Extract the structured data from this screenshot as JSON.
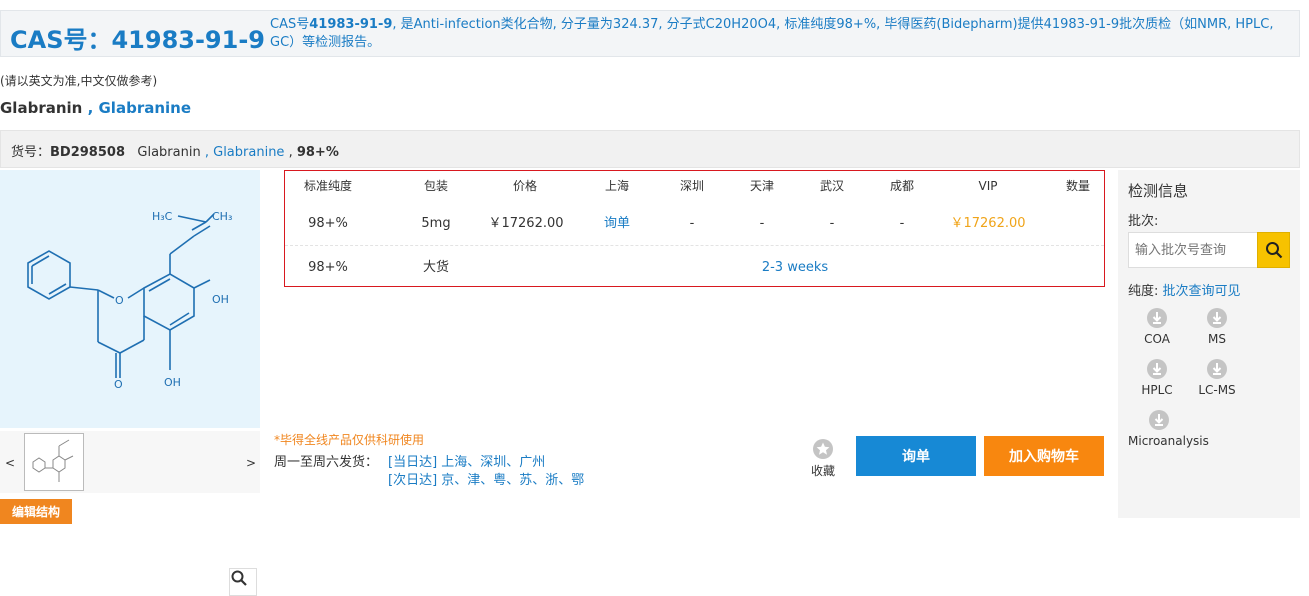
{
  "header": {
    "cas_title": "CAS号：41983-91-9",
    "desc_prefix": "CAS号",
    "desc_cas": "41983-91-9",
    "desc_rest": ", 是Anti-infection类化合物, 分子量为324.37, 分子式C20H20O4, 标准纯度98+%, 毕得医药(Bidepharm)提供41983-91-9批次质检（如NMR, HPLC, GC）等检测报告。"
  },
  "note": "(请以英文为准,中文仅做参考)",
  "product": {
    "name": "Glabranin",
    "separator": " , ",
    "alias": "Glabranine"
  },
  "item_bar": {
    "label": "货号：",
    "code": "BD298508",
    "name": "Glabranin",
    "separator": " , ",
    "alias": "Glabranine",
    "purity_sep": " , ",
    "purity": "98+%"
  },
  "structure": {
    "labels": {
      "ch3_left": "H₃C",
      "ch3_right": "CH₃",
      "oh_top": "OH",
      "oh_bottom": "OH",
      "o_ring": "O",
      "o_ketone": "O"
    }
  },
  "icons": {
    "zoom": "magnifier-icon",
    "search": "search-icon",
    "download": "download-icon",
    "star": "star-icon"
  },
  "thumbs": {
    "prev": "<",
    "next": ">"
  },
  "edit_button": "编辑结构",
  "table": {
    "headers": [
      "标准纯度",
      "包装",
      "价格",
      "上海",
      "深圳",
      "天津",
      "武汉",
      "成都",
      "VIP",
      "数量"
    ],
    "rows": [
      {
        "purity": "98+%",
        "pack": "5mg",
        "price": "￥17262.00",
        "shanghai": "询单",
        "shenzhen": "-",
        "tianjin": "-",
        "wuhan": "-",
        "chengdu": "-",
        "vip": "￥17262.00"
      },
      {
        "purity": "98+%",
        "pack": "大货",
        "lead_time": "2-3 weeks"
      }
    ]
  },
  "side": {
    "title": "检测信息",
    "batch_label": "批次:",
    "batch_placeholder": "输入批次号查询",
    "purity_label": "纯度: ",
    "purity_link": "批次查询可见",
    "downloads": [
      "COA",
      "MS",
      "HPLC",
      "LC-MS",
      "Microanalysis"
    ]
  },
  "footer": {
    "notice": "*毕得全线产品仅供科研使用",
    "ship_label": "周一至周六发货：",
    "ship_same_day": "[当日达] 上海、深圳、广州",
    "ship_next_day": "[次日达] 京、津、粤、苏、浙、鄂",
    "favorite": "收藏",
    "inquiry": "询单",
    "add_cart": "加入购物车"
  },
  "colors": {
    "brand_blue": "#1a7cc4",
    "button_blue": "#1789d5",
    "button_orange": "#f8870f",
    "vip_gold": "#f0a419",
    "table_border": "#d8181f"
  }
}
